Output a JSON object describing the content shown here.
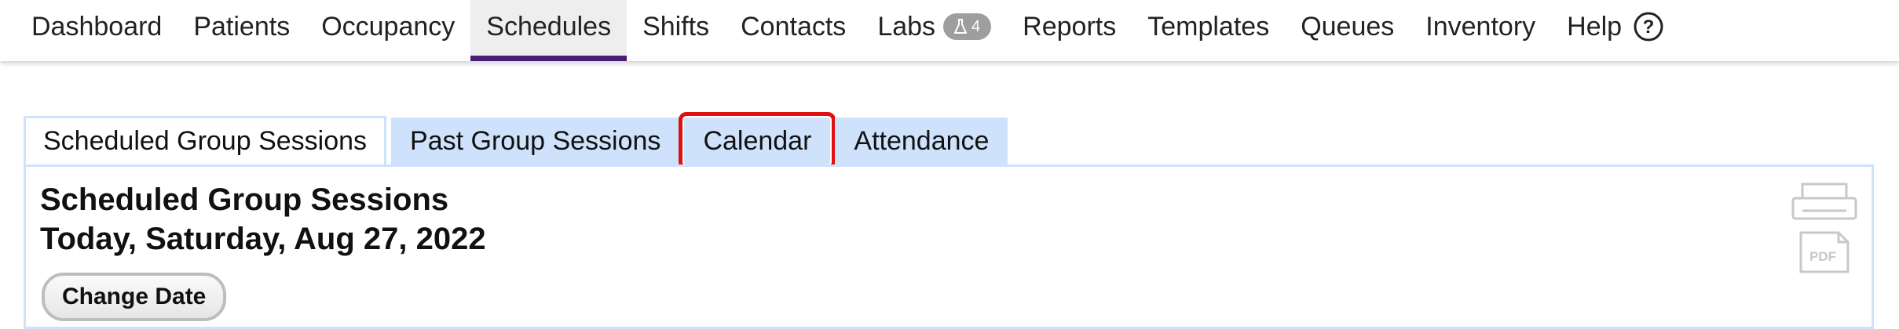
{
  "nav": {
    "items": [
      {
        "label": "Dashboard"
      },
      {
        "label": "Patients"
      },
      {
        "label": "Occupancy"
      },
      {
        "label": "Schedules",
        "active": true
      },
      {
        "label": "Shifts"
      },
      {
        "label": "Contacts"
      },
      {
        "label": "Labs",
        "badge": "4"
      },
      {
        "label": "Reports"
      },
      {
        "label": "Templates"
      },
      {
        "label": "Queues"
      },
      {
        "label": "Inventory"
      },
      {
        "label": "Help"
      }
    ],
    "help_icon_glyph": "?",
    "active_color": "#4b1c78"
  },
  "subtabs": [
    {
      "label": "Scheduled Group Sessions",
      "active": true
    },
    {
      "label": "Past Group Sessions"
    },
    {
      "label": "Calendar",
      "highlighted": true
    },
    {
      "label": "Attendance"
    }
  ],
  "panel": {
    "title": "Scheduled Group Sessions",
    "date": "Today, Saturday, Aug 27, 2022",
    "change_date_label": "Change Date",
    "pdf_icon_text": "PDF"
  },
  "colors": {
    "tab_bg": "#cfe2fb",
    "highlight": "#e01010"
  }
}
